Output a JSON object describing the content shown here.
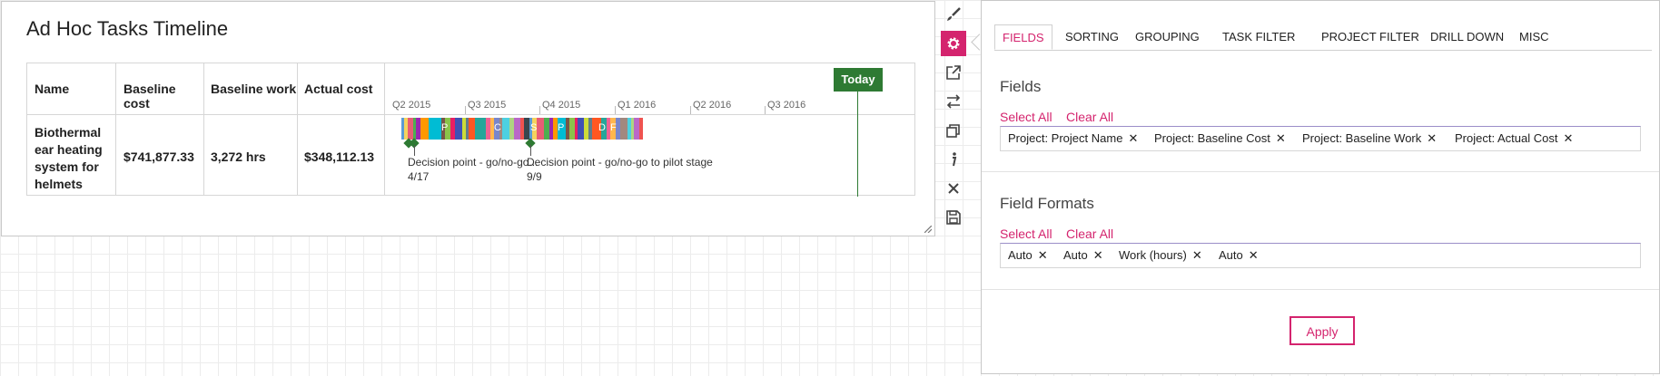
{
  "widget": {
    "title": "Ad Hoc Tasks Timeline",
    "columns": [
      "Name",
      "Baseline cost",
      "Baseline work",
      "Actual cost"
    ],
    "row": {
      "name": "Biothermal ear heating system for helmets",
      "baseline_cost": "$741,877.33",
      "baseline_work": "3,272 hrs",
      "actual_cost": "$348,112.13"
    },
    "timeline": {
      "today_label": "Today",
      "quarters": [
        "Q2 2015",
        "Q3 2015",
        "Q4 2015",
        "Q1 2016",
        "Q2 2016",
        "Q3 2016"
      ],
      "segment_labels": [
        "P",
        "C",
        "S",
        "P",
        "D",
        "F"
      ],
      "milestones": [
        {
          "label": "Decision point - go/no-go...",
          "date": "4/17"
        },
        {
          "label": "Decision point - go/no-go to pilot stage",
          "date": "9/9"
        }
      ]
    }
  },
  "toolbar": {
    "icons": [
      "brush-icon",
      "gear-icon",
      "external-link-icon",
      "swap-icon",
      "copy-icon",
      "info-icon",
      "close-icon",
      "save-icon"
    ],
    "active": "gear-icon"
  },
  "settings": {
    "tabs": [
      "FIELDS",
      "SORTING",
      "GROUPING",
      "TASK FILTER",
      "PROJECT FILTER",
      "DRILL DOWN",
      "MISC"
    ],
    "active_tab": "FIELDS",
    "fields": {
      "title": "Fields",
      "select_all": "Select All",
      "clear_all": "Clear All",
      "chips": [
        "Project: Project Name",
        "Project: Baseline Cost",
        "Project: Baseline Work",
        "Project: Actual Cost"
      ]
    },
    "field_formats": {
      "title": "Field Formats",
      "select_all": "Select All",
      "clear_all": "Clear All",
      "chips": [
        "Auto",
        "Auto",
        "Work (hours)",
        "Auto"
      ]
    },
    "apply_label": "Apply"
  },
  "colors": {
    "accent": "#d4246e",
    "today_green": "#2e7a33",
    "milestone_green": "#2e7a33"
  }
}
